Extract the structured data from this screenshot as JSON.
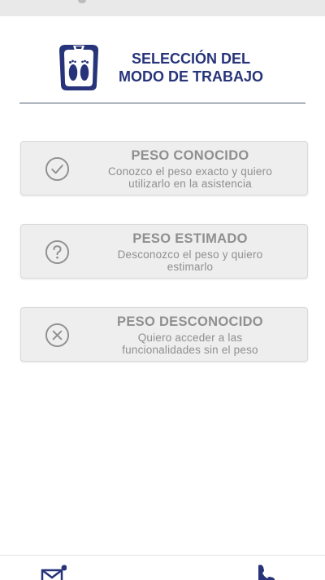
{
  "header": {
    "title_line1": "SELECCIÓN DEL",
    "title_line2": "MODO DE TRABAJO",
    "logo_icon": "scale-feet-icon"
  },
  "modes": [
    {
      "icon": "check-circle-icon",
      "title": "PESO CONOCIDO",
      "desc_line1": "Conozco el peso exacto y quiero",
      "desc_line2": "utilizarlo en la asistencia"
    },
    {
      "icon": "question-circle-icon",
      "title": "PESO ESTIMADO",
      "desc_line1": "Desconozco el peso y quiero",
      "desc_line2": "estimarlo"
    },
    {
      "icon": "x-circle-icon",
      "title": "PESO DESCONOCIDO",
      "desc_line1": "Quiero acceder a las",
      "desc_line2": "funcionalidades sin el peso"
    }
  ],
  "bottom_nav": {
    "left_icon": "mail-notification-icon",
    "right_icon": "phone-icon"
  },
  "colors": {
    "brand": "#27347a",
    "card_bg": "#eeeeee",
    "card_text": "#8f8f8f"
  }
}
